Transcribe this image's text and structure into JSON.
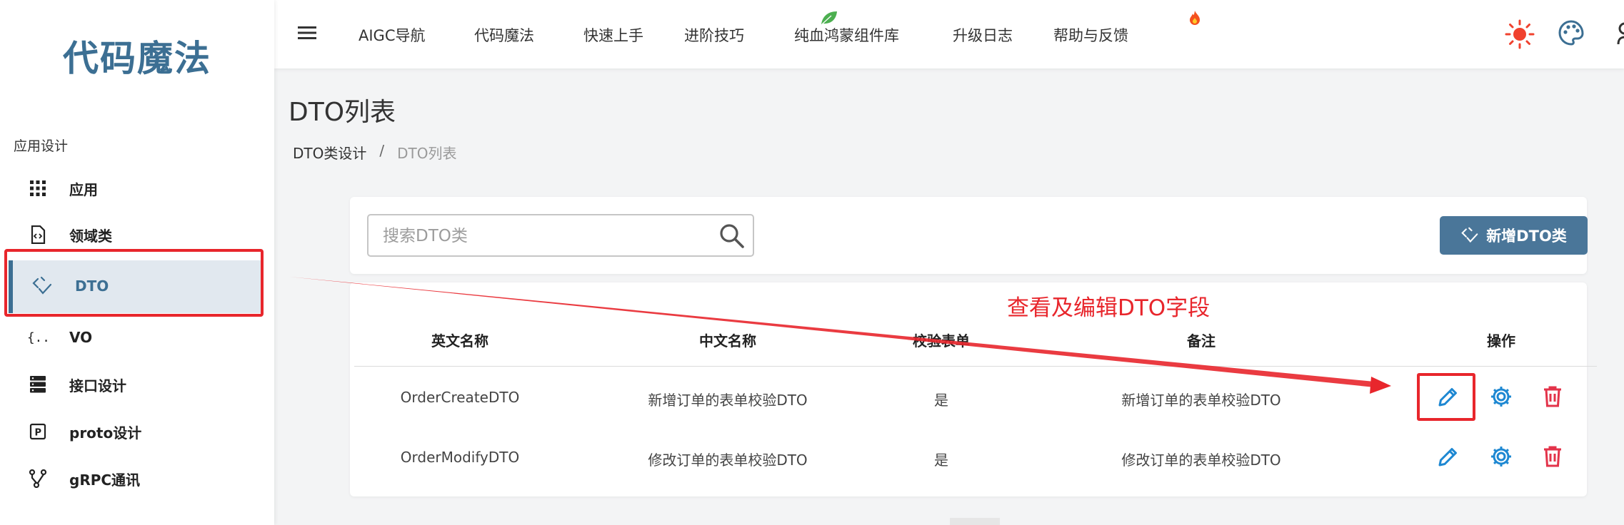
{
  "app": {
    "logo_text": "代码魔法"
  },
  "sidebar": {
    "section_title": "应用设计",
    "items": [
      {
        "label": "应用",
        "icon": "grid-icon"
      },
      {
        "label": "领域类",
        "icon": "code-file-icon"
      },
      {
        "label": "DTO",
        "icon": "dto-icon",
        "active": true
      },
      {
        "label": "VO",
        "icon": "braces-icon"
      },
      {
        "label": "接口设计",
        "icon": "server-icon"
      },
      {
        "label": "proto设计",
        "icon": "proto-icon"
      },
      {
        "label": "gRPC通讯",
        "icon": "branch-icon"
      }
    ]
  },
  "topbar": {
    "nav": [
      "AIGC导航",
      "代码魔法",
      "快速上手",
      "进阶技巧",
      "纯血鸿蒙组件库",
      "升级日志",
      "帮助与反馈"
    ],
    "icons": [
      "menu-icon",
      "leaf-icon",
      "fire-icon",
      "sun-icon",
      "palette-icon",
      "user-icon"
    ]
  },
  "page": {
    "title": "DTO列表",
    "breadcrumb": [
      "DTO类设计",
      "DTO列表"
    ],
    "breadcrumb_separator": "/"
  },
  "search": {
    "placeholder": "搜索DTO类",
    "value": ""
  },
  "toolbar": {
    "add_label": "新增DTO类"
  },
  "annotation": {
    "text": "查看及编辑DTO字段"
  },
  "table": {
    "headers": [
      "英文名称",
      "中文名称",
      "校验表单",
      "备注",
      "操作"
    ],
    "rows": [
      {
        "english": "OrderCreateDTO",
        "chinese": "新增订单的表单校验DTO",
        "validate": "是",
        "remark": "新增订单的表单校验DTO"
      },
      {
        "english": "OrderModifyDTO",
        "chinese": "修改订单的表单校验DTO",
        "validate": "是",
        "remark": "修改订单的表单校验DTO"
      }
    ]
  },
  "colors": {
    "brand": "#3c6f93",
    "button": "#4a7699",
    "annotation_red": "#e8262c",
    "edit_blue": "#1e88d2",
    "delete_red": "#e3334a",
    "sun_red": "#f0412e"
  }
}
